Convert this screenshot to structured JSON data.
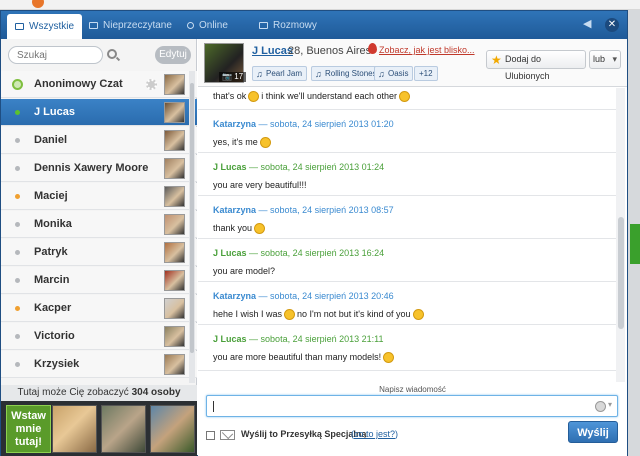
{
  "tabs": [
    {
      "label": "Wszystkie",
      "active": true
    },
    {
      "label": "Nieprzeczytane",
      "active": false
    },
    {
      "label": "Online",
      "active": false
    },
    {
      "label": "Rozmowy",
      "active": false
    }
  ],
  "left": {
    "search_placeholder": "Szukaj",
    "edit_label": "Edytuj",
    "contacts": [
      {
        "name": "Anonimowy Czat",
        "status": "anon",
        "selected": false
      },
      {
        "name": "J Lucas",
        "status": "online",
        "selected": true
      },
      {
        "name": "Daniel",
        "status": "offline",
        "selected": false
      },
      {
        "name": "Dennis Xawery Moore",
        "status": "offline",
        "selected": false
      },
      {
        "name": "Maciej",
        "status": "away",
        "selected": false
      },
      {
        "name": "Monika",
        "status": "offline",
        "selected": false
      },
      {
        "name": "Patryk",
        "status": "offline",
        "selected": false
      },
      {
        "name": "Marcin",
        "status": "offline",
        "selected": false
      },
      {
        "name": "Kacper",
        "status": "away",
        "selected": false
      },
      {
        "name": "Victorio",
        "status": "offline",
        "selected": false
      },
      {
        "name": "Krzysiek",
        "status": "offline",
        "selected": false
      }
    ],
    "seen_by_prefix": "Tutaj może Cię zobaczyć",
    "seen_by_count": "304 osoby",
    "visitor_me_label": "Wstaw mnie tutaj!"
  },
  "profile": {
    "name": "J Lucas",
    "age_city": "28, Buenos Aires",
    "near_link": "Zobacz, jak jest blisko...",
    "photo_count": "17",
    "tags": [
      "Pearl Jam",
      "Rolling Stones",
      "Oasis",
      "+12"
    ],
    "favorite_label": "Dodaj do Ulubionych",
    "or_label": "lub"
  },
  "messages": [
    {
      "author": "",
      "date": "",
      "text_before": "that's ok",
      "text_middle": "i think we'll understand each other",
      "text_after": "",
      "smileys": 2
    },
    {
      "author": "Katarzyna",
      "date": "sobota, 24 sierpień 2013 01:20",
      "color": "blue",
      "text_before": "yes, it's me",
      "text_middle": "",
      "text_after": "",
      "smileys": 1
    },
    {
      "author": "J Lucas",
      "date": "sobota, 24 sierpień 2013 01:24",
      "color": "green",
      "text_before": "you are very beautiful!!!",
      "text_middle": "",
      "text_after": "",
      "smileys": 0
    },
    {
      "author": "Katarzyna",
      "date": "sobota, 24 sierpień 2013 08:57",
      "color": "blue",
      "text_before": "thank you",
      "text_middle": "",
      "text_after": "",
      "smileys": 1
    },
    {
      "author": "J Lucas",
      "date": "sobota, 24 sierpień 2013 16:24",
      "color": "green",
      "text_before": "you are model?",
      "text_middle": "",
      "text_after": "",
      "smileys": 0
    },
    {
      "author": "Katarzyna",
      "date": "sobota, 24 sierpień 2013 20:46",
      "color": "blue",
      "text_before": "hehe I wish I was",
      "text_middle": "no I'm not but it's kind of you",
      "text_after": "",
      "smileys": 2
    },
    {
      "author": "J Lucas",
      "date": "sobota, 24 sierpień 2013 21:11",
      "color": "green",
      "text_before": "you are more beautiful than many models!",
      "text_middle": "",
      "text_after": "",
      "smileys": 1
    }
  ],
  "compose": {
    "label": "Napisz wiadomość",
    "value": "",
    "special_label": "Wyślij to Przesyłką Specjalną",
    "special_what": "co to jest?",
    "send_label": "Wyślij"
  },
  "colors": {
    "accent": "#2f74b8",
    "online": "#5cc12e",
    "away": "#f0a030",
    "offline": "#b5b8bc",
    "author_blue": "#3a8ad0",
    "author_green": "#4aa03a"
  },
  "icons": {
    "tab_all": "chat-bubble-icon",
    "tab_unread": "envelope-icon",
    "tab_online": "signal-icon",
    "tab_conv": "chat-bubble-icon",
    "volume": "speaker-icon",
    "close": "close-icon",
    "search": "search-icon",
    "pin": "location-pin-icon",
    "star": "star-icon",
    "music": "music-note-icon",
    "emoticon": "smiley-icon",
    "special": "envelope-icon"
  }
}
